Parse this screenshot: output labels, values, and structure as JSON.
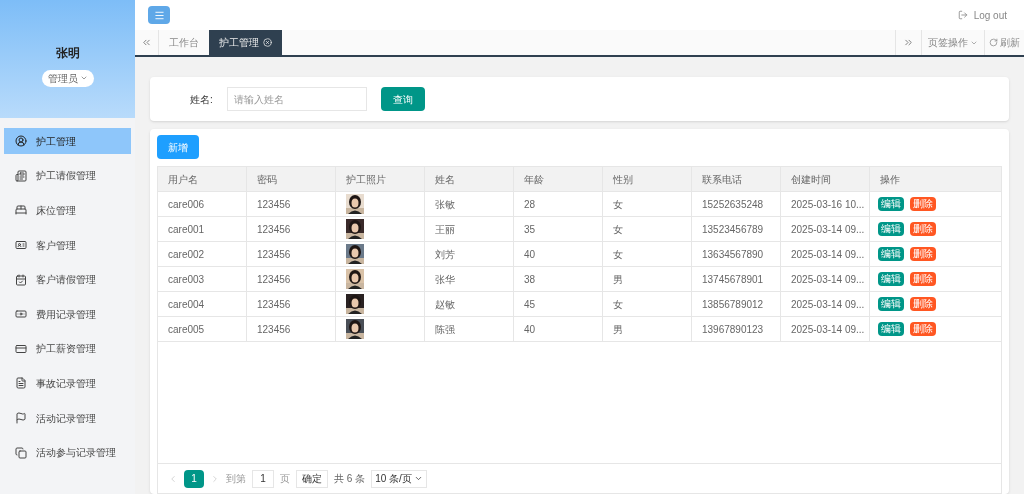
{
  "user": {
    "name": "张明",
    "role": "管理员"
  },
  "sidebar": {
    "items": [
      {
        "label": "护工管理",
        "selected": true
      },
      {
        "label": "护工请假管理",
        "selected": false
      },
      {
        "label": "床位管理",
        "selected": false
      },
      {
        "label": "客户管理",
        "selected": false
      },
      {
        "label": "客户请假管理",
        "selected": false
      },
      {
        "label": "费用记录管理",
        "selected": false
      },
      {
        "label": "护工薪资管理",
        "selected": false
      },
      {
        "label": "事故记录管理",
        "selected": false
      },
      {
        "label": "活动记录管理",
        "selected": false
      },
      {
        "label": "活动参与记录管理",
        "selected": false
      }
    ]
  },
  "topbar": {
    "logout": "Log out"
  },
  "tabs": [
    {
      "label": "工作台",
      "selected": false,
      "closable": false
    },
    {
      "label": "护工管理",
      "selected": true,
      "closable": true
    }
  ],
  "tab_actions": {
    "page_ops": "页签操作",
    "refresh": "刷新"
  },
  "search": {
    "label": "姓名:",
    "placeholder": "请输入姓名",
    "button": "查询"
  },
  "add_button": "新增",
  "table": {
    "columns": [
      "用户名",
      "密码",
      "护工照片",
      "姓名",
      "年龄",
      "性别",
      "联系电话",
      "创建时间",
      "操作"
    ],
    "rows": [
      {
        "username": "care006",
        "password": "123456",
        "name": "张敏",
        "age": "28",
        "gender": "女",
        "phone": "15252635248",
        "created": "2025-03-16 10...",
        "edit": "编辑",
        "delete": "删除"
      },
      {
        "username": "care001",
        "password": "123456",
        "name": "王丽",
        "age": "35",
        "gender": "女",
        "phone": "13523456789",
        "created": "2025-03-14 09...",
        "edit": "编辑",
        "delete": "删除"
      },
      {
        "username": "care002",
        "password": "123456",
        "name": "刘芳",
        "age": "40",
        "gender": "女",
        "phone": "13634567890",
        "created": "2025-03-14 09...",
        "edit": "编辑",
        "delete": "删除"
      },
      {
        "username": "care003",
        "password": "123456",
        "name": "张华",
        "age": "38",
        "gender": "男",
        "phone": "13745678901",
        "created": "2025-03-14 09...",
        "edit": "编辑",
        "delete": "删除"
      },
      {
        "username": "care004",
        "password": "123456",
        "name": "赵敏",
        "age": "45",
        "gender": "女",
        "phone": "13856789012",
        "created": "2025-03-14 09...",
        "edit": "编辑",
        "delete": "删除"
      },
      {
        "username": "care005",
        "password": "123456",
        "name": "陈强",
        "age": "40",
        "gender": "男",
        "phone": "13967890123",
        "created": "2025-03-14 09...",
        "edit": "编辑",
        "delete": "删除"
      }
    ]
  },
  "pagination": {
    "pages": [
      {
        "label": "1",
        "selected": true
      }
    ],
    "goto_label": "到第",
    "goto_value": "1",
    "page_unit": "页",
    "confirm": "确定",
    "total": "共 6 条",
    "page_size": "10 条/页"
  }
}
